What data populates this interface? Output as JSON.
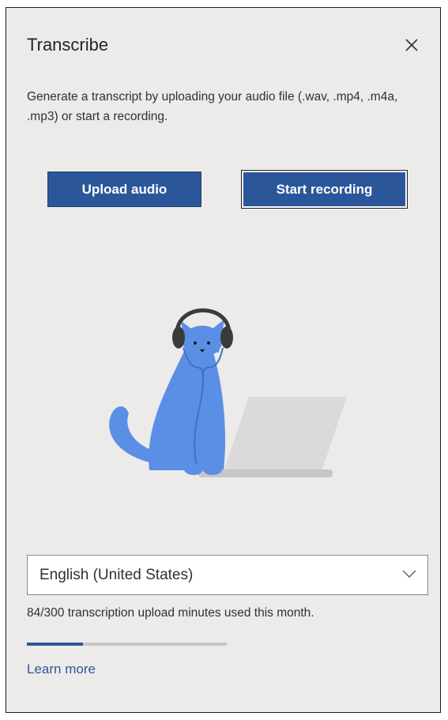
{
  "pane": {
    "title": "Transcribe",
    "close_icon": "close-icon",
    "description": "Generate a transcript by uploading your audio file (.wav, .mp4, .m4a, .mp3) or start a recording."
  },
  "actions": {
    "upload_label": "Upload audio",
    "record_label": "Start recording"
  },
  "illustration": {
    "icon": "cat-with-headphones-and-laptop-illustration"
  },
  "language": {
    "selected": "English (United States)",
    "icon": "chevron-down-icon"
  },
  "usage": {
    "text": "84/300 transcription upload minutes used this month.",
    "used": 84,
    "total": 300,
    "fraction": 0.28
  },
  "links": {
    "learn_more": "Learn more"
  },
  "colors": {
    "accent": "#2b579a",
    "pane_background": "#edebe9",
    "cat": "#5b8fe6",
    "progress_track": "#c8c6c4"
  }
}
